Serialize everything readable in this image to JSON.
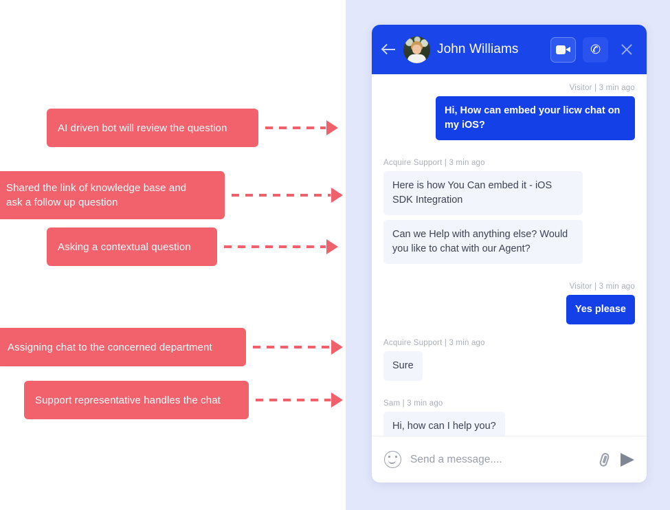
{
  "theme": {
    "left_panel_bg": "#ffffff",
    "right_panel_bg": "#e3e7fb",
    "annotation_red": "#f2626d",
    "brand_blue": "#1440e8",
    "header_blue": "#1a45e8",
    "incoming_bubble_bg": "#f3f5fd"
  },
  "annotations": [
    {
      "id": "ai-bot-review",
      "label": "AI driven bot will review the question"
    },
    {
      "id": "shared-knowledge-base",
      "label_line1": "Shared the link of knowledge  base and",
      "label_line2": " ask a follow up question"
    },
    {
      "id": "contextual-question",
      "label": "Asking a contextual question"
    },
    {
      "id": "assign-department",
      "label": "Assigning chat to the concerned department"
    },
    {
      "id": "support-rep-handles",
      "label": "Support representative handles the chat"
    }
  ],
  "chat": {
    "header": {
      "title": "John Williams",
      "back_icon": "back-arrow-icon",
      "avatar_alt": "John Williams",
      "video_icon": "video-camera-icon",
      "phone_icon": "✆",
      "close_icon": "close-icon"
    },
    "messages": [
      {
        "direction": "out",
        "meta": "Visitor  |  3 min ago",
        "text": "Hi, How can embed your licw chat on my iOS?"
      },
      {
        "direction": "in",
        "meta": "Acquire Support  |  3 min ago",
        "text": "Here is how You Can embed it - iOS SDK Integration",
        "text2": "Can we Help with anything else? Would you like to chat with our Agent?"
      },
      {
        "direction": "out",
        "meta": "Visitor  |  3 min ago",
        "text": "Yes please"
      },
      {
        "direction": "in",
        "meta": "Acquire Support  |  3 min ago",
        "text": "Sure"
      },
      {
        "direction": "in",
        "meta": "Sam  |  3 min ago",
        "text": "Hi, how can I help you?"
      }
    ],
    "composer": {
      "placeholder": "Send a message....",
      "value": "",
      "emoji_icon": "emoji-smiley-icon",
      "attach_icon": "paperclip-icon",
      "send_icon": "send-arrow-icon"
    }
  }
}
